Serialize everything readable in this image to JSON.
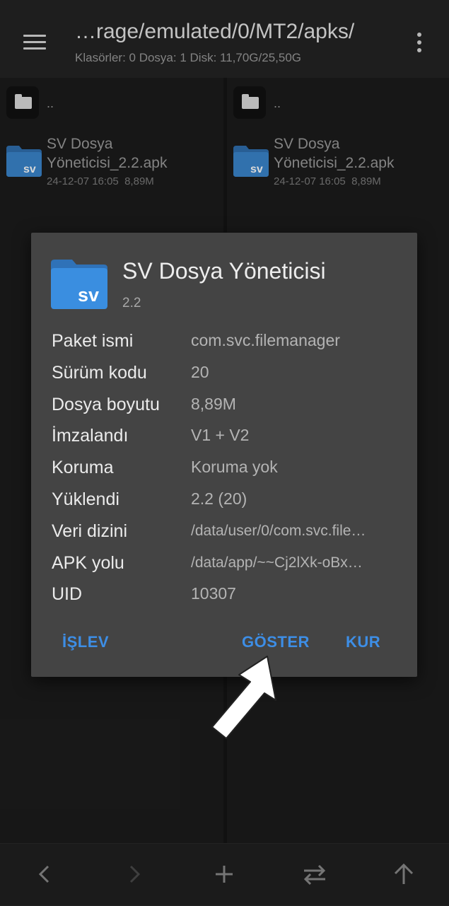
{
  "header": {
    "path": "…rage/emulated/0/MT2/apks/",
    "summary": "Klasörler: 0  Dosya: 1  Disk: 11,70G/25,50G",
    "menu_icon": "hamburger-menu-icon",
    "more_icon": "more-vertical-icon"
  },
  "panes": [
    {
      "parent_label": "..",
      "file": {
        "name": "SV Dosya Yöneticisi_2.2.apk",
        "date": "24-12-07 16:05",
        "size": "8,89M",
        "icon_text": "sv"
      }
    },
    {
      "parent_label": "..",
      "file": {
        "name": "SV Dosya Yöneticisi_2.2.apk",
        "date": "24-12-07 16:05",
        "size": "8,89M",
        "icon_text": "sv"
      }
    }
  ],
  "dialog": {
    "app_name": "SV Dosya Yöneticisi",
    "version": "2.2",
    "icon_text": "sv",
    "rows": [
      {
        "key": "Paket ismi",
        "value": "com.svc.filemanager"
      },
      {
        "key": "Sürüm kodu",
        "value": "20"
      },
      {
        "key": "Dosya boyutu",
        "value": "8,89M"
      },
      {
        "key": "İmzalandı",
        "value": "V1 + V2"
      },
      {
        "key": "Koruma",
        "value": "Koruma yok"
      },
      {
        "key": "Yüklendi",
        "value": "2.2 (20)"
      },
      {
        "key": "Veri dizini",
        "value": "/data/user/0/com.svc.file…"
      },
      {
        "key": "APK yolu",
        "value": "/data/app/~~Cj2lXk-oBx…"
      },
      {
        "key": "UID",
        "value": "10307"
      }
    ],
    "buttons": {
      "function": "İŞLEV",
      "show": "GÖSTER",
      "install": "KUR"
    }
  },
  "bottom_bar": {
    "icons": [
      "back-arrow-icon",
      "forward-arrow-icon",
      "add-icon",
      "swap-icon",
      "up-arrow-icon"
    ]
  },
  "colors": {
    "accent": "#3d8ee6",
    "app_icon_blue": "#3a8ee0",
    "dialog_bg": "#444444",
    "background": "#1c1c1c"
  }
}
